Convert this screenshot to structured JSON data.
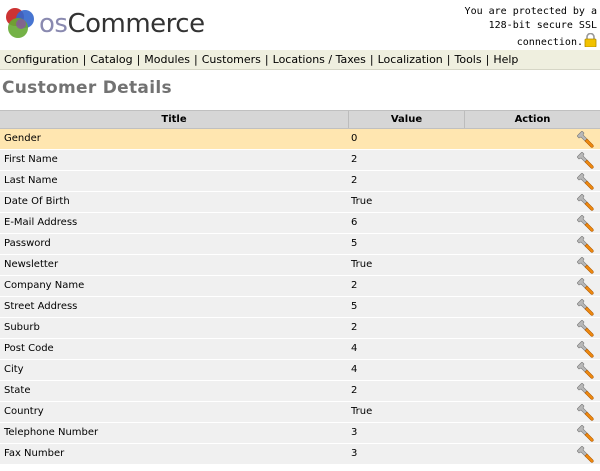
{
  "header": {
    "logo_prefix": "os",
    "logo_suffix": "Commerce",
    "ssl_lines": [
      "You are protected by a",
      "128-bit secure SSL",
      "connection."
    ]
  },
  "nav": {
    "items": [
      "Configuration",
      "Catalog",
      "Modules",
      "Customers",
      "Locations / Taxes",
      "Localization",
      "Tools",
      "Help"
    ],
    "separator": "|"
  },
  "page": {
    "title": "Customer Details"
  },
  "table": {
    "columns": {
      "title": "Title",
      "value": "Value",
      "action": "Action"
    },
    "rows": [
      {
        "title": "Gender",
        "value": "0"
      },
      {
        "title": "First Name",
        "value": "2"
      },
      {
        "title": "Last Name",
        "value": "2"
      },
      {
        "title": "Date Of Birth",
        "value": "True"
      },
      {
        "title": "E-Mail Address",
        "value": "6"
      },
      {
        "title": "Password",
        "value": "5"
      },
      {
        "title": "Newsletter",
        "value": "True"
      },
      {
        "title": "Company Name",
        "value": "2"
      },
      {
        "title": "Street Address",
        "value": "5"
      },
      {
        "title": "Suburb",
        "value": "2"
      },
      {
        "title": "Post Code",
        "value": "4"
      },
      {
        "title": "City",
        "value": "4"
      },
      {
        "title": "State",
        "value": "2"
      },
      {
        "title": "Country",
        "value": "True"
      },
      {
        "title": "Telephone Number",
        "value": "3"
      },
      {
        "title": "Fax Number",
        "value": "3"
      }
    ],
    "selected_row": 0,
    "action_icon": "edit-wrench-icon"
  },
  "colors": {
    "nav_background": "#efefdf",
    "selected_row": "#ffe6b0",
    "row_background": "#f0f0f0",
    "header_background": "#d6d6d6",
    "title_text": "#727272"
  }
}
